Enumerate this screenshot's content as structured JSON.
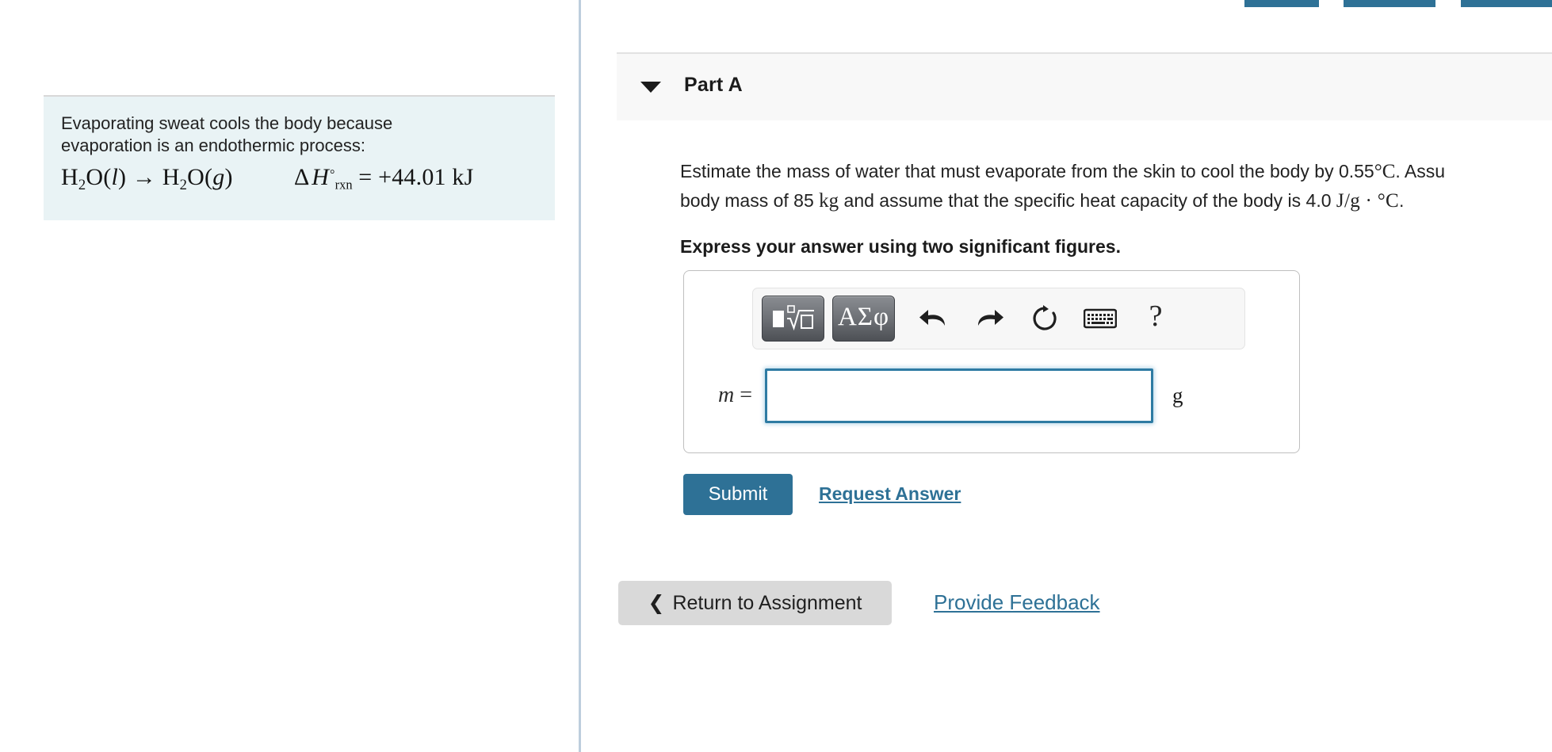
{
  "top_stub_buttons": [
    {
      "name": "stub-1",
      "color": "#2e7196"
    },
    {
      "name": "stub-2",
      "color": "#2e7196"
    },
    {
      "name": "stub-3",
      "color": "#2e7196"
    }
  ],
  "info_panel": {
    "paragraph_line1": "Evaporating sweat cools the body because",
    "paragraph_line2": "evaporation is an endothermic process:",
    "equation": {
      "reactant": "H₂O(l)",
      "arrow": "→",
      "product": "H₂O(g)",
      "delta_symbol": "Δ",
      "enthalpy_symbol": "H",
      "enthalpy_subscript": "rxn",
      "enthalpy_superscript": "°",
      "equals": "=",
      "value": "+44.01 kJ",
      "plain_text": "H2O(l) → H2O(g)   ΔH°rxn = +44.01 kJ"
    },
    "background_color": "#e9f3f5"
  },
  "part": {
    "toggle_icon": "triangle-down-icon",
    "title": "Part A",
    "header_background": "#f8f8f8"
  },
  "question": {
    "line1": "Estimate the mass of water that must evaporate from the skin to cool the body by 0.55 °C. Assu",
    "line1_pre": "Estimate the mass of water that must evaporate from the skin to cool the body by 0.55",
    "line1_unit": "°C",
    "line1_post": ". Assu",
    "line2_pre": "body mass of 85",
    "line2_unit1": "kg",
    "line2_mid": "and assume that the specific heat capacity of the body is 4.0",
    "line2_unit2": "J/g · °C",
    "line2_post": ".",
    "express_note": "Express your answer using two significant figures."
  },
  "toolbar": {
    "template_button": {
      "name": "math-template-button",
      "glyph": "▪ⁿ√▫"
    },
    "greek_button": {
      "name": "greek-symbols-button",
      "label": "ΑΣφ"
    },
    "undo_icon": "undo-arrow-icon",
    "redo_icon": "redo-arrow-icon",
    "reset_icon": "reset-circular-arrow-icon",
    "keyboard_icon": "keyboard-icon",
    "help_icon": "question-mark-icon",
    "help_label": "?"
  },
  "answer": {
    "variable_label": "m =",
    "variable_symbol": "m",
    "equals": "=",
    "value": "",
    "placeholder": "",
    "units": "g",
    "focus_border_color": "#2e7ba3"
  },
  "actions": {
    "submit_label": "Submit",
    "submit_color": "#2e7196",
    "request_answer_label": "Request Answer",
    "link_color": "#2e7196"
  },
  "footer": {
    "return_chevron": "❮",
    "return_label": "Return to Assignment",
    "return_background": "#d9d9d9",
    "provide_feedback_label": "Provide Feedback"
  }
}
